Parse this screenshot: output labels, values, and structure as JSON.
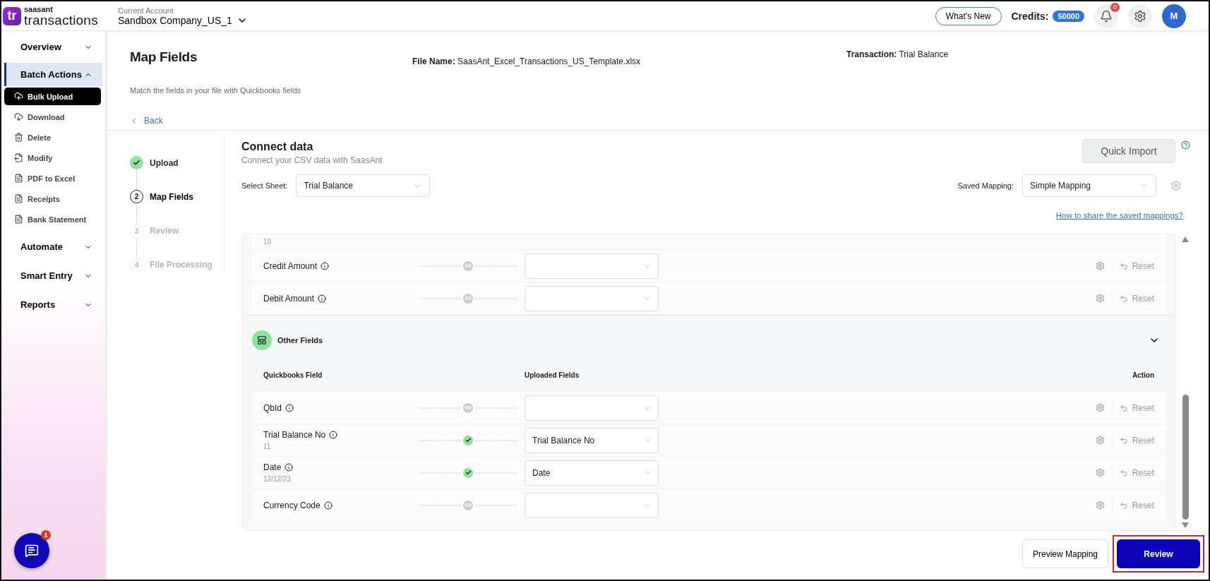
{
  "brand": {
    "mark": "tr",
    "top": "saasant",
    "name": "transactions"
  },
  "account": {
    "label": "Current Account",
    "name": "Sandbox Company_US_1"
  },
  "topbar": {
    "whats_new": "What's New",
    "credits_label": "Credits:",
    "credits": "50000",
    "notifications": "0",
    "avatar": "M"
  },
  "sidebar": [
    {
      "label": "Overview",
      "expanded": false
    },
    {
      "label": "Batch Actions",
      "expanded": true,
      "children": [
        {
          "label": "Bulk Upload",
          "selected": true
        },
        {
          "label": "Download",
          "selected": false
        },
        {
          "label": "Delete",
          "selected": false
        },
        {
          "label": "Modify",
          "selected": false
        },
        {
          "label": "PDF to Excel",
          "selected": false
        },
        {
          "label": "Receipts",
          "selected": false
        },
        {
          "label": "Bank Statement",
          "selected": false
        }
      ]
    },
    {
      "label": "Automate",
      "expanded": false
    },
    {
      "label": "Smart Entry",
      "expanded": false
    },
    {
      "label": "Reports",
      "expanded": false
    }
  ],
  "chat_badge": "1",
  "page": {
    "title": "Map Fields",
    "subtitle": "Match the fields in your file with Quickbooks fields",
    "back": "Back",
    "file_label": "File Name:",
    "file_name": "SaasAnt_Excel_Transactions_US_Template.xlsx",
    "transaction_label": "Transaction:",
    "transaction": "Trial Balance"
  },
  "steps": [
    {
      "label": "Upload",
      "completed": true,
      "selected": false
    },
    {
      "number": "2",
      "label": "Map Fields",
      "completed": false,
      "selected": true
    },
    {
      "number": "3",
      "label": "Review",
      "completed": false,
      "selected": false
    },
    {
      "number": "4",
      "label": "File Processing",
      "completed": false,
      "selected": false
    }
  ],
  "connect": {
    "title": "Connect data",
    "subtitle": "Connect your CSV data with SaasAnt",
    "quick_import": "Quick Import",
    "sheet_label": "Select Sheet:",
    "sheet": "Trial Balance",
    "saved_label": "Saved Mapping:",
    "saved": "Simple Mapping",
    "link": "How to share the saved mappings?"
  },
  "sections": [
    {
      "rows": [
        {
          "kind": "partial",
          "sample": "10"
        },
        {
          "kind": "field",
          "name": "Credit Amount",
          "mapped": false,
          "reset": "Reset"
        },
        {
          "kind": "field",
          "name": "Debit Amount",
          "mapped": false,
          "reset": "Reset"
        }
      ]
    },
    {
      "title": "Other Fields",
      "expanded": true,
      "columns": [
        "Quickbooks Field",
        "Uploaded Fields",
        "Action"
      ],
      "rows": [
        {
          "kind": "field",
          "name": "QbId",
          "mapped": false,
          "reset": "Reset"
        },
        {
          "kind": "field",
          "name": "Trial Balance No",
          "sample": "11",
          "mapped": true,
          "value": "Trial Balance No",
          "reset": "Reset"
        },
        {
          "kind": "field",
          "name": "Date",
          "sample": "12/12/23",
          "mapped": true,
          "value": "Date",
          "reset": "Reset"
        },
        {
          "kind": "field",
          "name": "Currency Code",
          "mapped": false,
          "reset": "Reset"
        }
      ]
    }
  ],
  "footer": {
    "preview": "Preview Mapping",
    "review": "Review"
  }
}
